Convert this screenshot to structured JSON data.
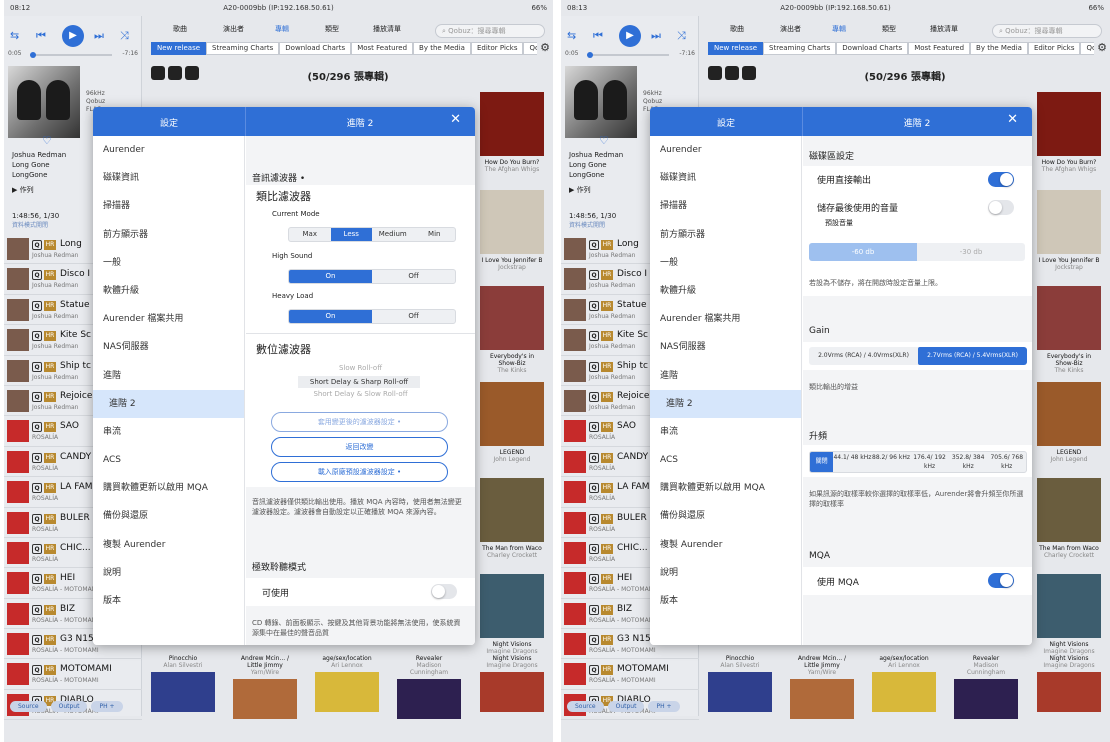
{
  "statusbars": [
    {
      "time": "08:12",
      "device": "A20-0009bb (IP:192.168.50.61)",
      "battery": "66%"
    },
    {
      "time": "08:13",
      "device": "A20-0009bb (IP:192.168.50.61)",
      "battery": "66%"
    }
  ],
  "player": {
    "elapsed": "0:05",
    "remaining": "-7:16",
    "format": [
      "96kHz",
      "Qobuz",
      "FLAC"
    ],
    "track": [
      "Joshua Redman",
      "Long Gone",
      "LongGone"
    ],
    "playlist_label": "▶ 作列",
    "queue_time": "1:48:56, 1/30",
    "queue_mode": "資料模式開閉"
  },
  "tracks": [
    {
      "name": "Long",
      "artist": "Joshua Redman",
      "red": false
    },
    {
      "name": "Disco I",
      "artist": "Joshua Redman",
      "red": false
    },
    {
      "name": "Statue",
      "artist": "Joshua Redman",
      "red": false
    },
    {
      "name": "Kite Sc",
      "artist": "Joshua Redman",
      "red": false
    },
    {
      "name": "Ship tc",
      "artist": "Joshua Redman",
      "red": false
    },
    {
      "name": "Rejoice",
      "artist": "Joshua Redman",
      "red": false
    },
    {
      "name": "SAO",
      "artist": "ROSALÍA",
      "red": true
    },
    {
      "name": "CANDY",
      "artist": "ROSALÍA",
      "red": true
    },
    {
      "name": "LA FAM",
      "artist": "ROSALÍA",
      "red": true
    },
    {
      "name": "BULER",
      "artist": "ROSALÍA",
      "red": true
    },
    {
      "name": "CHIC...",
      "artist": "ROSALÍA",
      "red": true
    },
    {
      "name": "HEI",
      "artist": "ROSALÍA - MOTOMAMI",
      "red": true
    },
    {
      "name": "BIZ",
      "artist": "ROSALÍA - MOTOMAMI",
      "red": true
    },
    {
      "name": "G3 N15",
      "artist": "ROSALÍA - MOTOMAMI",
      "red": true
    },
    {
      "name": "MOTOMAMI",
      "artist": "ROSALÍA - MOTOMAMI",
      "red": true
    },
    {
      "name": "DIABLO",
      "artist": "ROSALÍA - MOTOMAMI",
      "red": true
    }
  ],
  "bottom_buttons": [
    "Source",
    "Output",
    "PH +"
  ],
  "nav": {
    "items": [
      "歌曲",
      "演出者",
      "專輯",
      "類型",
      "播放清單"
    ],
    "search_placeholder": "Qobuz：搜尋專輯"
  },
  "tabs": [
    "New release",
    "Streaming Charts",
    "Download Charts",
    "Most Featured",
    "By the Media",
    "Editor Picks",
    "Qo"
  ],
  "album_count": "(50/296 張專輯)",
  "albums_right": [
    {
      "title": "How Do You Burn?",
      "artist": "The Afghan Whigs",
      "color": "#7d1a12"
    },
    {
      "title": "I Love You Jennifer B",
      "artist": "Jockstrap",
      "color": "#cfc7b8"
    },
    {
      "title": "Everybody's in Show-Biz",
      "artist": "The Kinks",
      "color": "#8b3d3a"
    },
    {
      "title": "LEGEND",
      "artist": "John Legend",
      "color": "#9a5a2a"
    },
    {
      "title": "The Man from Waco",
      "artist": "Charley Crockett",
      "color": "#6a5d3e"
    },
    {
      "title": "Night Visions",
      "artist": "Imagine Dragons",
      "color": "#3d5d6e"
    }
  ],
  "albums_bottom": [
    {
      "title": "Pinocchio",
      "artist": "Alan Silvestri",
      "color": "#2f3f8d"
    },
    {
      "title": "Andrew Mcin... / Little Jimmy",
      "artist": "Yarn/Wire",
      "color": "#b06a3a"
    },
    {
      "title": "age/sex/location",
      "artist": "Ari Lennox",
      "color": "#d8b83a"
    },
    {
      "title": "Revealer",
      "artist": "Madison Cunningham",
      "color": "#2d2050"
    },
    {
      "title": "Night Visions",
      "artist": "Imagine Dragons",
      "color": "#a83a2a"
    }
  ],
  "dialog": {
    "left_title": "設定",
    "menu": [
      "Aurender",
      "磁碟資訊",
      "掃描器",
      "前方顯示器",
      "一般",
      "軟體升級",
      "Aurender 檔案共用",
      "NAS伺服器",
      "進階",
      "進階 2",
      "串流",
      "ACS",
      "購買軟體更新以啟用 MQA",
      "備份與還原",
      "複製 Aurender",
      "說明",
      "版本"
    ],
    "active_menu_index": 9
  },
  "panel1": {
    "title": "進階 2",
    "filter_header": "音訊濾波器 •",
    "analog_title": "類比濾波器",
    "current_mode_label": "Current Mode",
    "current_mode_options": [
      "Max",
      "Less",
      "Medium",
      "Min"
    ],
    "current_mode_selected": 1,
    "high_sound_label": "High Sound",
    "high_sound_options": [
      "On",
      "Off"
    ],
    "heavy_load_label": "Heavy Load",
    "heavy_load_options": [
      "On",
      "Off"
    ],
    "digital_title": "數位濾波器",
    "digital_options": [
      "Slow Roll-off",
      "Short Delay & Sharp Roll-off",
      "Short Delay & Slow Roll-off"
    ],
    "buttons": [
      "套用變更後的濾波器設定 •",
      "返回改變",
      "載入原廠預設濾波器設定 •"
    ],
    "note1": "音訊濾波器僅供類比輸出使用。播放 MQA 內容時，使用者無法變更濾波器設定。濾波器會自動設定以正確播放 MQA 來源內容。",
    "extreme_title": "極致聆聽模式",
    "extreme_toggle_label": "可使用",
    "note2": "CD 轉錄、前面板顯示、按鍵及其他背景功能將無法使用，使系統資源集中在最佳的聲音品質"
  },
  "panel2": {
    "title": "進階 2",
    "disk_title": "磁碟區設定",
    "direct_output_label": "使用直接輸出",
    "save_volume_label": "儲存最後使用的音量",
    "default_volume_label": "預設音量",
    "volume_options": [
      "-60 db",
      "-30 db"
    ],
    "volume_note": "若設為不儲存，將在開啟時設定音量上限。",
    "gain_title": "Gain",
    "gain_options": [
      "2.0Vrms (RCA) / 4.0Vrms(XLR)",
      "2.7Vrms (RCA) / 5.4Vrms(XLR)"
    ],
    "gain_note": "類比輸出的增益",
    "upsample_title": "升頻",
    "upsample_options": [
      "關閉",
      "44.1/ 48 kHz",
      "88.2/ 96 kHz",
      "176.4/ 192 kHz",
      "352.8/ 384 kHz",
      "705.6/ 768 kHz"
    ],
    "upsample_note": "如果訊源的取樣率較你選擇的取樣率低，Aurender將會升頻至你所選擇的取樣率",
    "mqa_title": "MQA",
    "mqa_label": "使用 MQA"
  },
  "colors": {
    "accent": "#2f6fd6"
  }
}
